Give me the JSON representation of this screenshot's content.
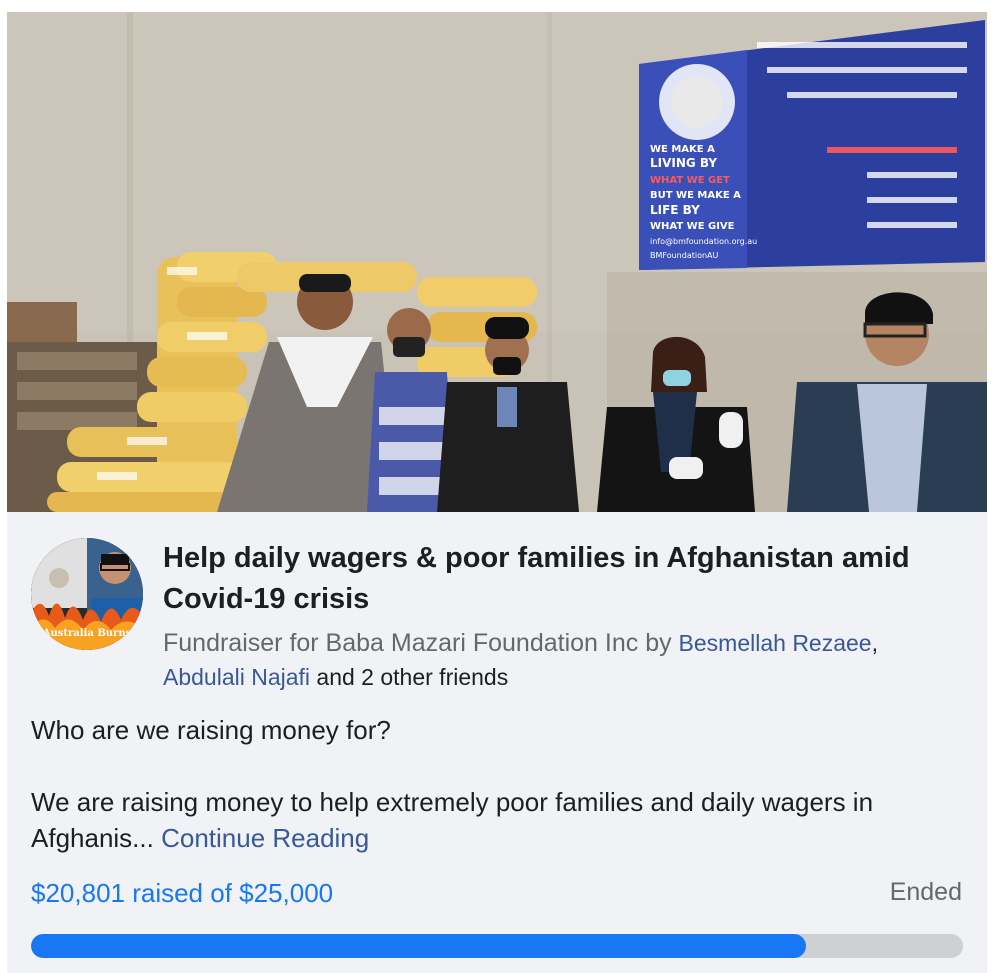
{
  "fundraiser": {
    "title": "Help daily wagers & poor families in Afghanistan amid Covid-19 crisis",
    "subtitle_prefix": "Fundraiser for Baba Mazari Foundation Inc by ",
    "organizer_1": "Besmellah Rezaee",
    "separator": ",",
    "organizer_2": "Abdulali Najafi",
    "others": " and 2 other friends",
    "description_line_1": "Who are we raising money for?",
    "description_line_2": "We are raising money to help extremely poor families and daily wagers in Afghanis... ",
    "continue_reading": "Continue Reading",
    "raised_text": "$20,801 raised of $25,000",
    "status": "Ended",
    "progress_fraction": 0.832
  },
  "banner": {
    "line_1": "WE MAKE A",
    "line_2": "LIVING BY",
    "line_3": "WHAT WE GET",
    "line_4": "BUT WE MAKE A",
    "line_5": "LIFE BY",
    "line_6": "WHAT WE GIVE",
    "email": "info@bmfoundation.org.au",
    "handle": "BMFoundationAU"
  },
  "avatar": {
    "caption": "Australia Burns"
  },
  "colors": {
    "link": "#385898",
    "accent": "#1877f2",
    "muted": "#65676b",
    "card_bg": "#f0f2f5",
    "track": "#ced0d4"
  }
}
